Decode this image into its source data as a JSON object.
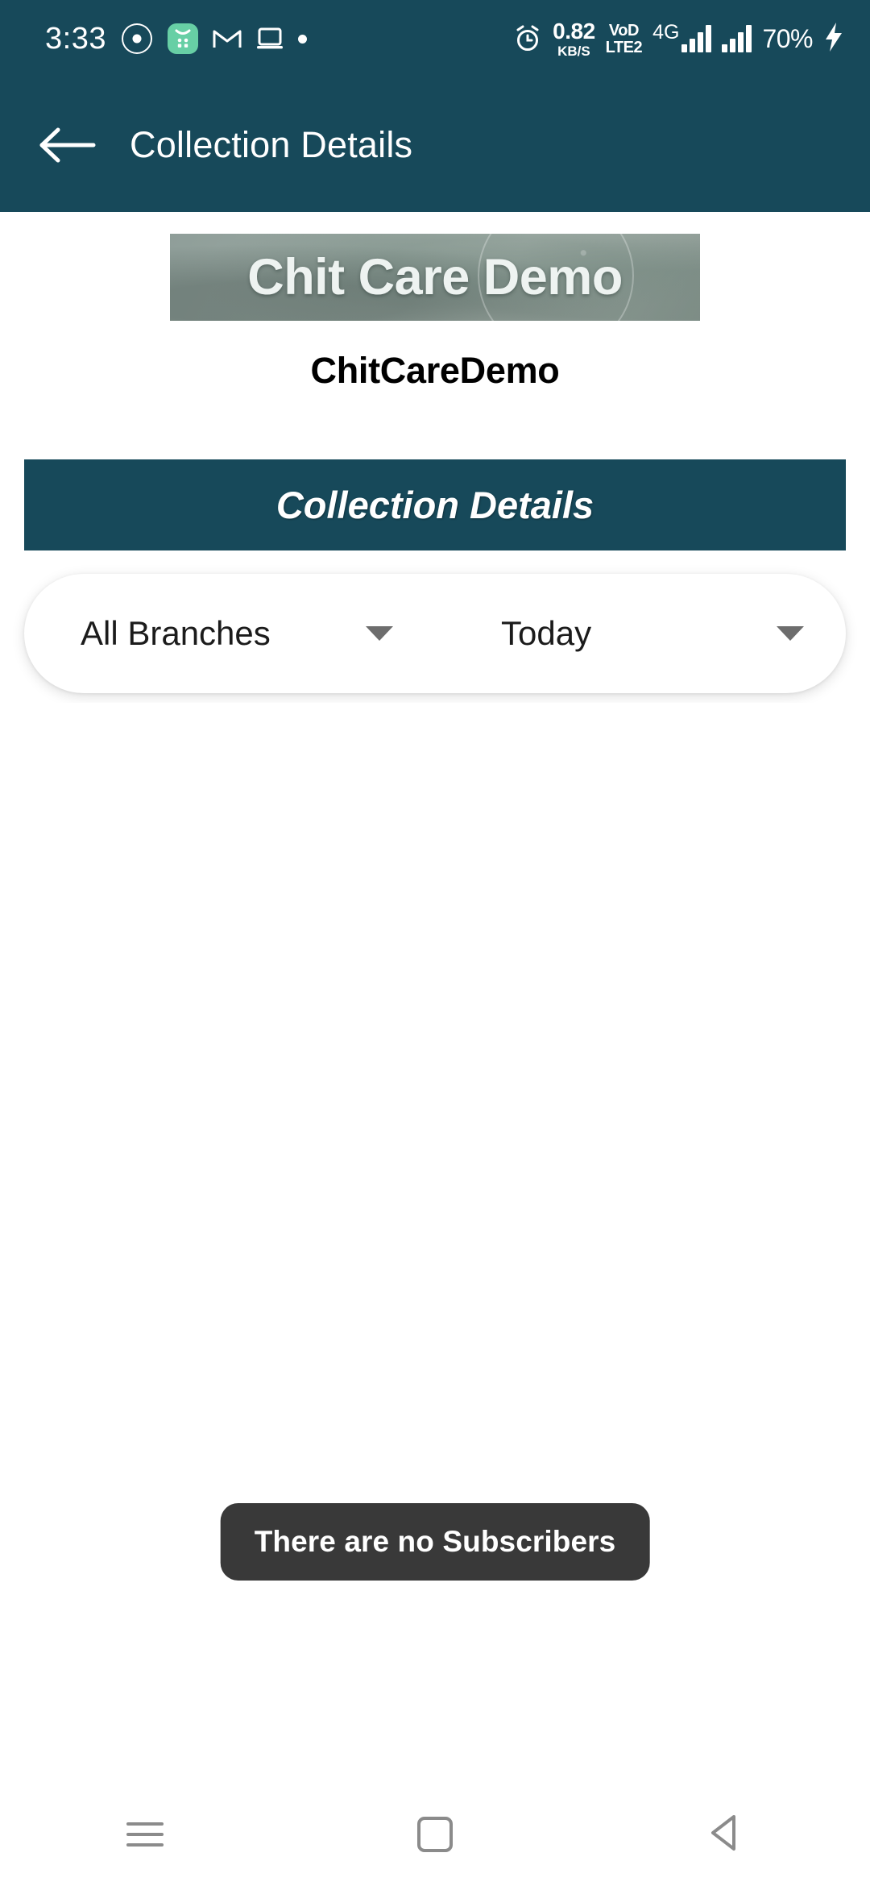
{
  "status_bar": {
    "time": "3:33",
    "icons_left": [
      "clover-icon",
      "green-app-icon",
      "gmail-icon",
      "laptop-icon",
      "dot-icon"
    ],
    "alarm_icon": "alarm-icon",
    "net_speed_value": "0.82",
    "net_speed_unit": "KB/S",
    "volte_line1": "VoD",
    "volte_line2": "LTE2",
    "network_type": "4G",
    "network_plus": "+",
    "battery": "70%",
    "charging_icon": "charging-bolt-icon"
  },
  "app_bar": {
    "back_icon": "back-arrow-icon",
    "title": "Collection Details"
  },
  "logo": {
    "banner_text": "Chit Care Demo",
    "company_name": "ChitCareDemo"
  },
  "section": {
    "title": "Collection Details"
  },
  "filters": {
    "branch": {
      "value": "All Branches",
      "caret_icon": "chevron-down-icon"
    },
    "period": {
      "value": "Today",
      "caret_icon": "chevron-down-icon"
    }
  },
  "toast": {
    "message": "There are no Subscribers"
  },
  "nav_bar": {
    "recents_label": "recents-icon",
    "home_label": "home-icon",
    "back_label": "back-icon"
  },
  "colors": {
    "primary_teal": "#17495a",
    "toast_bg": "#393939",
    "accent_green": "#67cfa5"
  }
}
